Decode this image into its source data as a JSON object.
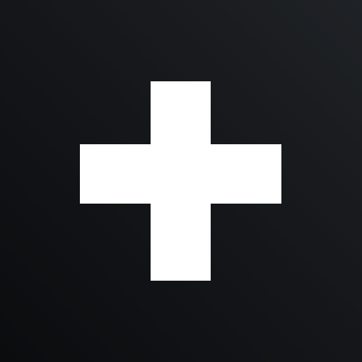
{
  "icon": {
    "name": "plus-icon",
    "foreground_color": "#ffffff",
    "background_gradient": [
      "#0b0c0e",
      "#15171a",
      "#1f2226"
    ]
  }
}
